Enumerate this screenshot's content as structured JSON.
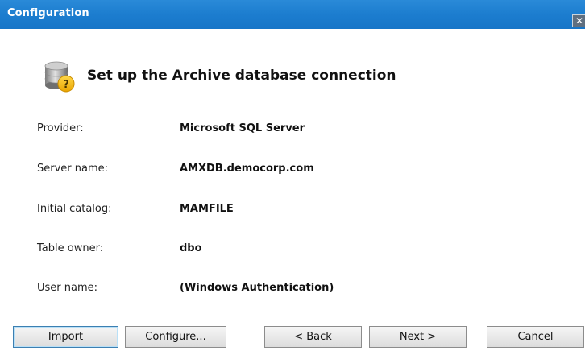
{
  "window": {
    "title": "Configuration",
    "close_glyph": "✕"
  },
  "header": {
    "icon": "database-question-icon",
    "text": "Set up the Archive database connection"
  },
  "fields": [
    {
      "label": "Provider:",
      "value": "Microsoft SQL Server"
    },
    {
      "label": "Server name:",
      "value": "AMXDB.democorp.com"
    },
    {
      "label": "Initial catalog:",
      "value": "MAMFILE"
    },
    {
      "label": "Table owner:",
      "value": "dbo"
    },
    {
      "label": "User name:",
      "value": "(Windows Authentication)"
    }
  ],
  "buttons": {
    "import": "Import",
    "configure": "Configure...",
    "back": "< Back",
    "next": "Next >",
    "cancel": "Cancel"
  },
  "colors": {
    "titlebar": "#1c7dcf",
    "title_text": "#ffffff",
    "icon_question_badge": "#f2b100"
  }
}
